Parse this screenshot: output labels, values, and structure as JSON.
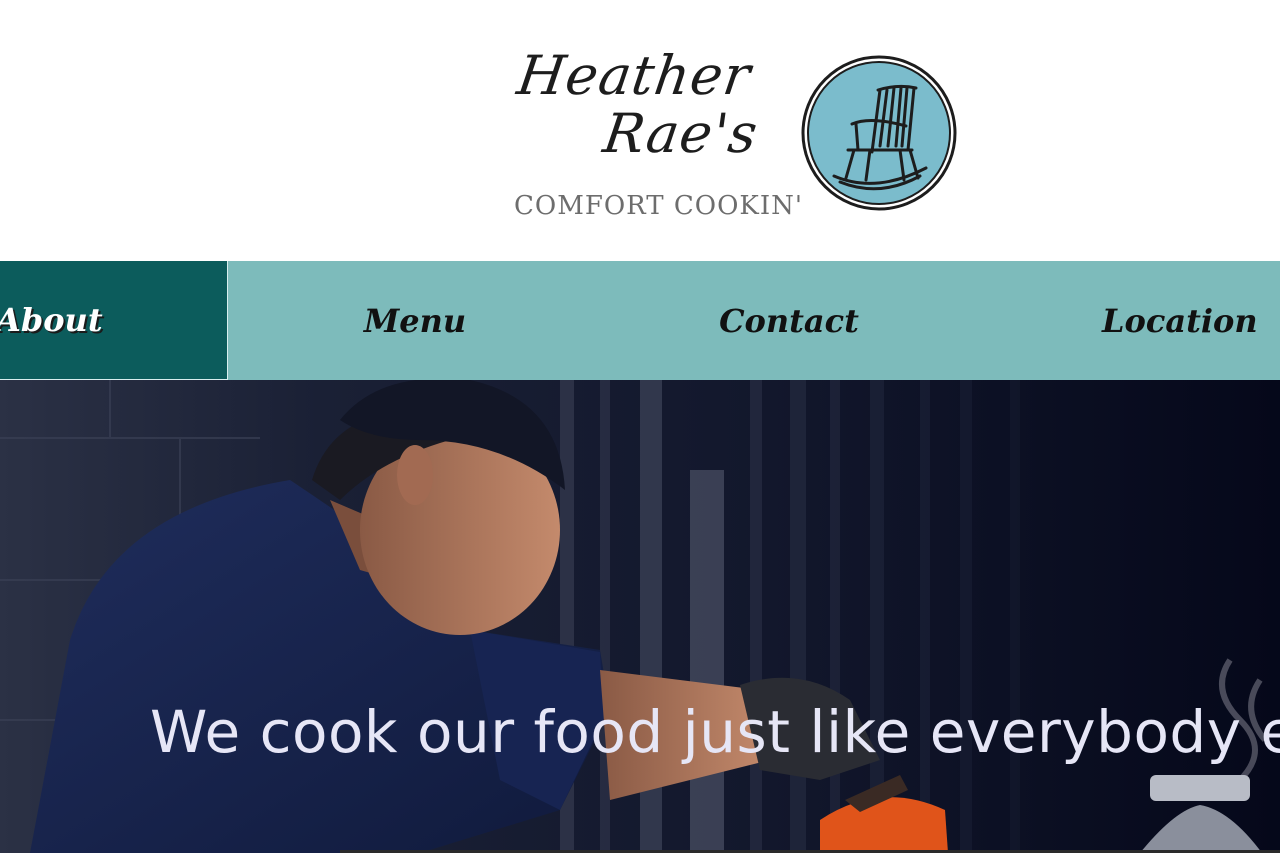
{
  "logo": {
    "line1": "Heather",
    "line2": "Rae's",
    "tagline": "COMFORT COOKIN'",
    "badge_icon": "rocking-chair-icon",
    "badge_color": "#7bbccc"
  },
  "nav": {
    "items": [
      {
        "label": "About",
        "active": true
      },
      {
        "label": "Menu",
        "active": false
      },
      {
        "label": "Contact",
        "active": false
      },
      {
        "label": "Location",
        "active": false
      }
    ],
    "bar_color": "#7dbbbb",
    "active_color": "#0c5c5c"
  },
  "hero": {
    "caption": "We cook our food just like everybody else"
  }
}
